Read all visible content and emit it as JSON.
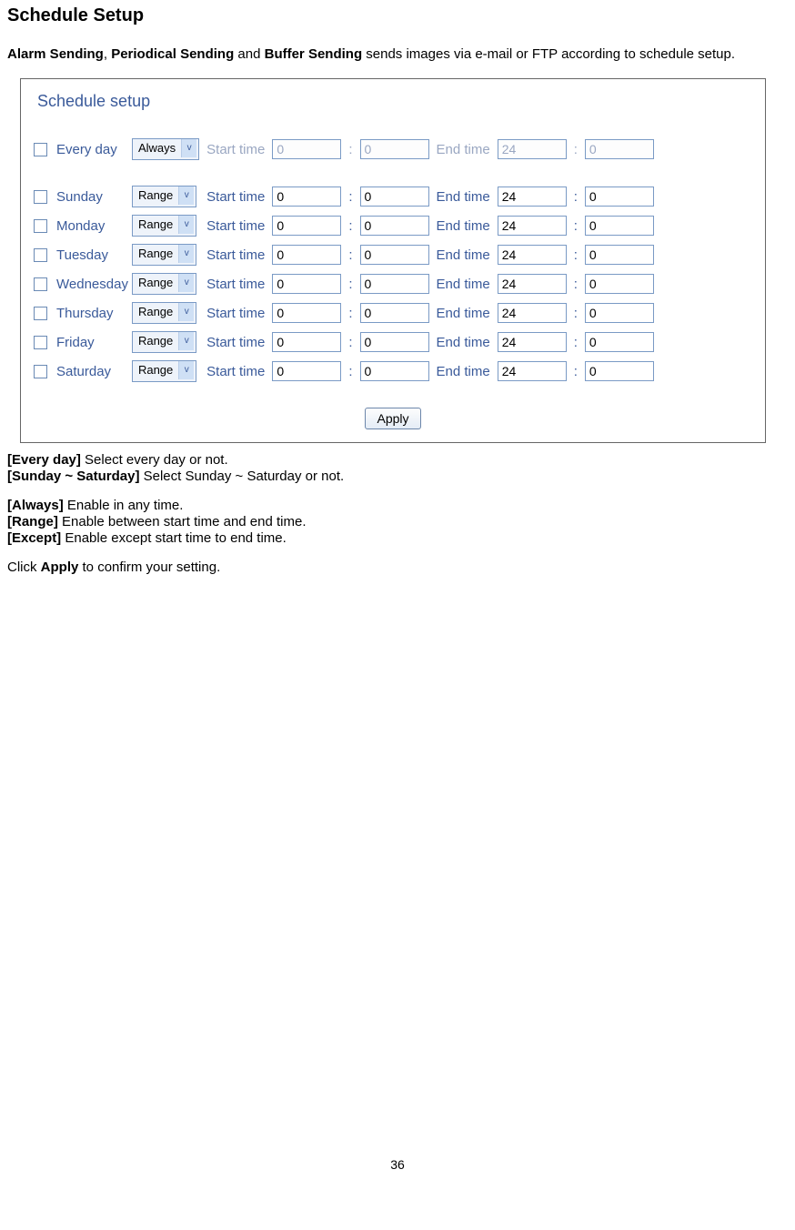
{
  "title": "Schedule Setup",
  "intro": {
    "b1": "Alarm Sending",
    "sep1": ", ",
    "b2": "Periodical Sending",
    "mid": " and ",
    "b3": "Buffer Sending",
    "tail": " sends images via e-mail or FTP according to schedule setup."
  },
  "ss": {
    "heading": "Schedule setup",
    "labels": {
      "start": "Start time",
      "end": "End time",
      "colon": ":",
      "apply": "Apply"
    },
    "rows": [
      {
        "day": "Every day",
        "mode": "Always",
        "sh": "0",
        "sm": "0",
        "eh": "24",
        "em": "0",
        "disabled": true
      },
      {
        "day": "Sunday",
        "mode": "Range",
        "sh": "0",
        "sm": "0",
        "eh": "24",
        "em": "0",
        "disabled": false
      },
      {
        "day": "Monday",
        "mode": "Range",
        "sh": "0",
        "sm": "0",
        "eh": "24",
        "em": "0",
        "disabled": false
      },
      {
        "day": "Tuesday",
        "mode": "Range",
        "sh": "0",
        "sm": "0",
        "eh": "24",
        "em": "0",
        "disabled": false
      },
      {
        "day": "Wednesday",
        "mode": "Range",
        "sh": "0",
        "sm": "0",
        "eh": "24",
        "em": "0",
        "disabled": false
      },
      {
        "day": "Thursday",
        "mode": "Range",
        "sh": "0",
        "sm": "0",
        "eh": "24",
        "em": "0",
        "disabled": false
      },
      {
        "day": "Friday",
        "mode": "Range",
        "sh": "0",
        "sm": "0",
        "eh": "24",
        "em": "0",
        "disabled": false
      },
      {
        "day": "Saturday",
        "mode": "Range",
        "sh": "0",
        "sm": "0",
        "eh": "24",
        "em": "0",
        "disabled": false
      }
    ]
  },
  "defs": {
    "l1b": "[Every day]",
    "l1": " Select every day or not.",
    "l2b": "[Sunday ~ Saturday]",
    "l2": " Select Sunday ~ Saturday or not.",
    "l3b": "[Always]",
    "l3": " Enable in any time.",
    "l4b": "[Range]",
    "l4": " Enable between start time and end time.",
    "l5b": "[Except]",
    "l5": " Enable except start time to end time.",
    "l6a": "Click ",
    "l6b": "Apply",
    "l6c": " to confirm your setting."
  },
  "page": "36"
}
